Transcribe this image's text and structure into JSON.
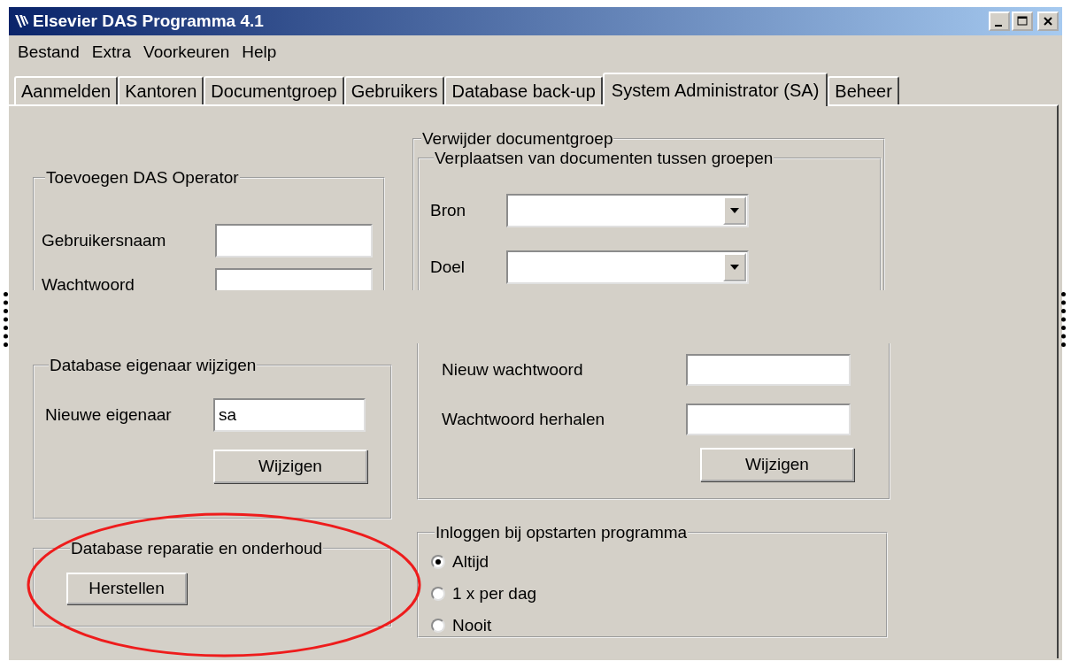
{
  "window": {
    "title": "Elsevier DAS Programma 4.1"
  },
  "menu": [
    "Bestand",
    "Extra",
    "Voorkeuren",
    "Help"
  ],
  "tabs": [
    {
      "label": "Aanmelden",
      "selected": false
    },
    {
      "label": "Kantoren",
      "selected": false
    },
    {
      "label": "Documentgroep",
      "selected": false
    },
    {
      "label": "Gebruikers",
      "selected": false
    },
    {
      "label": "Database back-up",
      "selected": false
    },
    {
      "label": "System Administrator (SA)",
      "selected": true
    },
    {
      "label": "Beheer",
      "selected": false
    }
  ],
  "operator_group": {
    "title": "Toevoegen DAS Operator",
    "fields": [
      {
        "label": "Gebruikersnaam"
      },
      {
        "label": "Wachtwoord"
      }
    ]
  },
  "document_group": {
    "title": "Verwijder documentgroep",
    "move_group": {
      "title": "Verplaatsen van documenten tussen groepen",
      "fields": [
        {
          "label": "Bron"
        },
        {
          "label": "Doel"
        }
      ]
    }
  },
  "owner_group": {
    "title": "Database eigenaar wijzigen",
    "label": "Nieuwe eigenaar",
    "value": "sa",
    "button": "Wijzigen"
  },
  "password_group": {
    "fields": [
      {
        "label": "Nieuw wachtwoord"
      },
      {
        "label": "Wachtwoord herhalen"
      }
    ],
    "button": "Wijzigen"
  },
  "repair_group": {
    "title": "Database reparatie en onderhoud",
    "button": "Herstellen"
  },
  "login_group": {
    "title": "Inloggen bij opstarten programma",
    "options": [
      {
        "label": "Altijd",
        "selected": true
      },
      {
        "label": "1 x per dag",
        "selected": false
      },
      {
        "label": "Nooit",
        "selected": false
      }
    ]
  }
}
